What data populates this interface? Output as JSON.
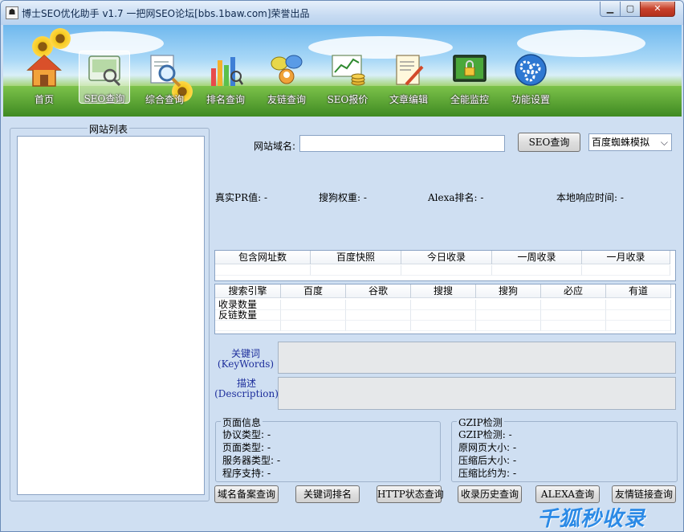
{
  "window": {
    "title": "博士SEO优化助手 v1.7 一把网SEO论坛[bbs.1baw.com]荣誉出品",
    "min_label": "▁",
    "max_label": "▢",
    "close_label": "✕"
  },
  "toolbar": {
    "items": [
      {
        "label": "首页",
        "icon": "home-icon"
      },
      {
        "label": "SEO查询",
        "icon": "seo-query-icon"
      },
      {
        "label": "综合查询",
        "icon": "magnifier-icon"
      },
      {
        "label": "排名查询",
        "icon": "bar-chart-icon"
      },
      {
        "label": "友链查询",
        "icon": "friend-link-icon"
      },
      {
        "label": "SEO报价",
        "icon": "money-chart-icon"
      },
      {
        "label": "文章编辑",
        "icon": "document-edit-icon"
      },
      {
        "label": "全能监控",
        "icon": "lock-monitor-icon"
      },
      {
        "label": "功能设置",
        "icon": "gears-icon"
      }
    ],
    "active_index": 1
  },
  "sidebar": {
    "title": "网站列表"
  },
  "query": {
    "domain_label": "网站域名:",
    "domain_value": "",
    "seo_button": "SEO查询",
    "spider_select": "百度蜘蛛模拟"
  },
  "stats": {
    "pr": "真实PR值: -",
    "sogou": "搜狗权重: -",
    "alexa": "Alexa排名: -",
    "response": "本地响应时间: -"
  },
  "table1": {
    "headers": [
      "包含网址数",
      "百度快照",
      "今日收录",
      "一周收录",
      "一月收录"
    ]
  },
  "table2": {
    "headers": [
      "搜索引擎",
      "百度",
      "谷歌",
      "搜搜",
      "搜狗",
      "必应",
      "有道"
    ],
    "rows": [
      {
        "label": "收录数量"
      },
      {
        "label": "反链数量"
      }
    ]
  },
  "keywords": {
    "label_cn": "关键词",
    "label_en": "(KeyWords)",
    "value": ""
  },
  "description": {
    "label_cn": "描述",
    "label_en": "(Description)",
    "value": ""
  },
  "page_info": {
    "title": "页面信息",
    "lines": [
      "协议类型: -",
      "页面类型: -",
      "服务器类型: -",
      "程序支持: -"
    ]
  },
  "gzip_info": {
    "title": "GZIP检测",
    "lines": [
      "GZIP检测: -",
      "原网页大小: -",
      "压缩后大小: -",
      "压缩比约为: -"
    ]
  },
  "bottom_buttons": [
    "域名备案查询",
    "关键词排名",
    "HTTP状态查询",
    "收录历史查询",
    "ALEXA查询",
    "友情链接查询"
  ],
  "watermark": "千狐秒收录"
}
